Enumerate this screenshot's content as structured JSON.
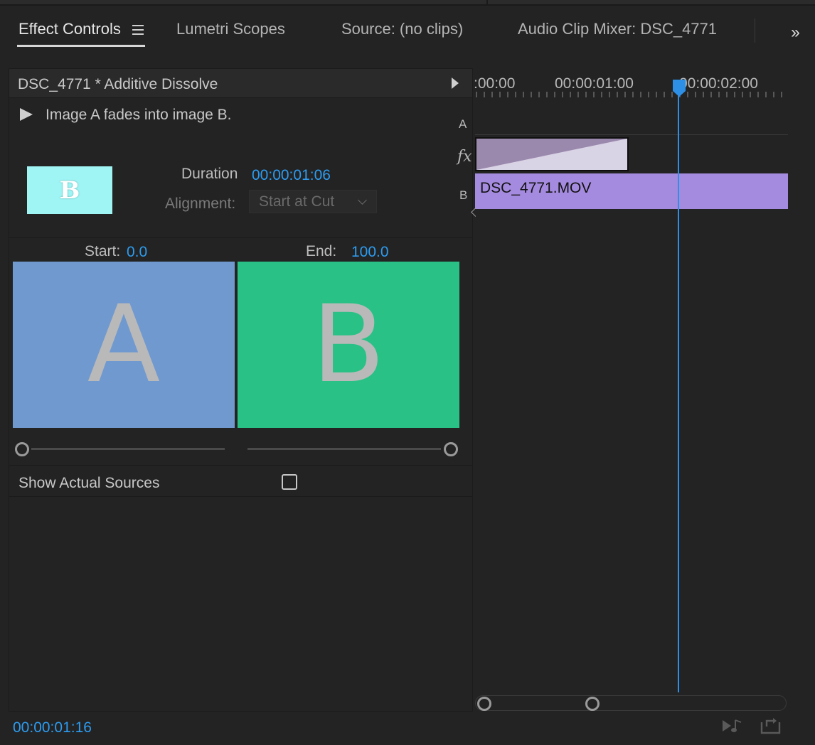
{
  "tabs": [
    {
      "label": "Effect Controls",
      "active": true
    },
    {
      "label": "Lumetri Scopes",
      "active": false
    },
    {
      "label": "Source: (no clips)",
      "active": false
    },
    {
      "label": "Audio Clip Mixer: DSC_4771",
      "active": false
    }
  ],
  "effect": {
    "header": "DSC_4771 * Additive Dissolve",
    "description": "Image A fades into image B.",
    "thumbnail_letter": "B",
    "duration_label": "Duration",
    "duration_value": "00:00:01:06",
    "alignment_label": "Alignment:",
    "alignment_value": "Start at Cut",
    "start_label": "Start:",
    "start_value": "0.0",
    "end_label": "End:",
    "end_value": "100.0",
    "preview_a": "A",
    "preview_b": "B",
    "show_sources_label": "Show Actual Sources",
    "show_sources_checked": false
  },
  "timeline": {
    "ruler_labels": [
      ":00:00",
      "00:00:01:00",
      "00:00:02:00"
    ],
    "track_a_label": "A",
    "track_b_label": "B",
    "fx_label": "fx",
    "clip_name": "DSC_4771.MOV"
  },
  "current_timecode": "00:00:01:16",
  "colors": {
    "accent_blue": "#2d9cf0",
    "preview_a_bg": "#7099cf",
    "preview_b_bg": "#29c185",
    "clip_purple": "#a58bdf",
    "thumbnail_bg": "#9ff4f4"
  },
  "icons": [
    "panel-menu-icon",
    "panel-overflow-icon",
    "play-triangle-icon",
    "play-audio-only-icon",
    "export-frame-icon"
  ]
}
